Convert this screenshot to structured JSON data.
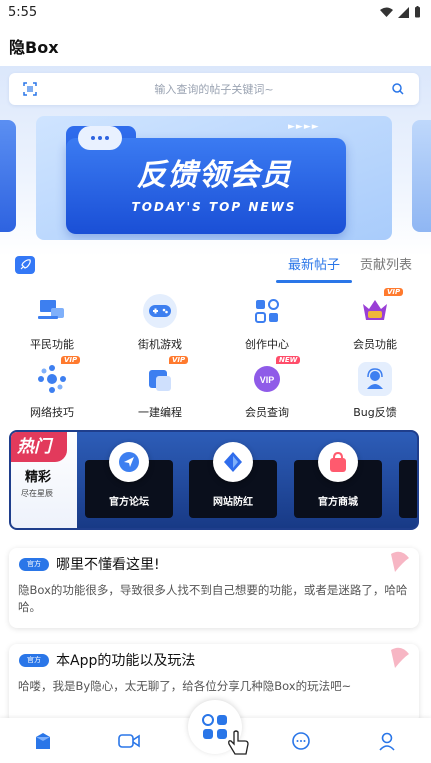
{
  "status_bar": {
    "time": "5:55"
  },
  "app_bar": {
    "title": "隐Box"
  },
  "search": {
    "placeholder": "输入查询的帖子关键词~"
  },
  "banner": {
    "title": "反馈领会员",
    "subtitle": "TODAY'S TOP NEWS",
    "arrows": "►►►►"
  },
  "tabs": {
    "active": "最新帖子",
    "other": "贡献列表"
  },
  "grid": {
    "items": [
      {
        "label": "平民功能",
        "icon": "laptop-icon"
      },
      {
        "label": "街机游戏",
        "icon": "gamepad-icon"
      },
      {
        "label": "创作中心",
        "icon": "apps-icon"
      },
      {
        "label": "会员功能",
        "icon": "crown-icon",
        "badge": "VIP"
      },
      {
        "label": "网络技巧",
        "icon": "network-icon",
        "badge": "VIP"
      },
      {
        "label": "一建编程",
        "icon": "cube-icon",
        "badge": "VIP"
      },
      {
        "label": "会员查询",
        "icon": "vip-icon",
        "badge": "NEW"
      },
      {
        "label": "Bug反馈",
        "icon": "support-icon"
      }
    ]
  },
  "hot": {
    "tag": "热门",
    "title": "精彩",
    "subtitle": "尽在星辰",
    "cards": [
      "官方论坛",
      "网站防红",
      "官方商城"
    ]
  },
  "posts": [
    {
      "tag": "官方",
      "title": "哪里不懂看这里!",
      "body": "隐Box的功能很多，导致很多人找不到自己想要的功能，或者是迷路了，哈哈哈。"
    },
    {
      "tag": "官方",
      "title": "本App的功能以及玩法",
      "body": "哈喽，我是By隐心，太无聊了，给各位分享几种隐Box的玩法吧~"
    }
  ],
  "colors": {
    "accent": "#2a76e8",
    "hot_tag": "#e23a5c",
    "badge": "#ff7a2e"
  }
}
